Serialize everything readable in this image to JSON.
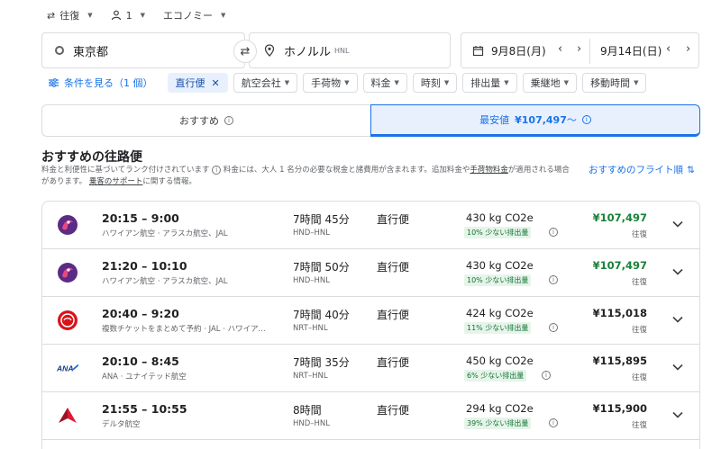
{
  "search": {
    "trip_type": "往復",
    "passengers": "1",
    "cabin": "エコノミー",
    "origin": "東京都",
    "destination": "ホノルル",
    "destination_code": "HNL",
    "depart_date": "9月8日(月)",
    "return_date": "9月14日(日)"
  },
  "filters": {
    "all_filters": "条件を見る（1 個）",
    "chips": [
      "直行便",
      "航空会社",
      "手荷物",
      "料金",
      "時刻",
      "排出量",
      "乗継地",
      "移動時間"
    ]
  },
  "tabs": {
    "recommended": "おすすめ",
    "cheapest_label": "最安値",
    "cheapest_price": "¥107,497",
    "cheapest_suffix": "〜"
  },
  "results": {
    "heading": "おすすめの往路便",
    "sub1": "料金と利便性に基づいてランク付けされています",
    "sub2": "料金には、大人 1 名分の必要な税金と諸費用が含まれます。追加料金や",
    "sub_link1": "手荷物料金",
    "sub3": "が適用される場合があります。",
    "sub_link2": "乗客のサポート",
    "sub4": "に関する情報。",
    "sort_label": "おすすめのフライト順"
  },
  "flights": [
    {
      "logo": "hawaiian",
      "times": "20:15 – 9:00",
      "airlines": "ハワイアン航空 · アラスカ航空、JAL",
      "duration": "7時間 45分",
      "route": "HND–HNL",
      "stops": "直行便",
      "co2": "430 kg CO2e",
      "badge": "10% 少ない排出量",
      "price": "¥107,497",
      "cheap": true,
      "trip": "往復"
    },
    {
      "logo": "hawaiian",
      "times": "21:20 – 10:10",
      "airlines": "ハワイアン航空 · アラスカ航空、JAL",
      "duration": "7時間 50分",
      "route": "HND–HNL",
      "stops": "直行便",
      "co2": "430 kg CO2e",
      "badge": "10% 少ない排出量",
      "price": "¥107,497",
      "cheap": true,
      "trip": "往復"
    },
    {
      "logo": "jal",
      "times": "20:40 – 9:20",
      "airlines": "複数チケットをまとめて予約 · JAL · ハワイアン航空",
      "duration": "7時間 40分",
      "route": "NRT–HNL",
      "stops": "直行便",
      "co2": "424 kg CO2e",
      "badge": "11% 少ない排出量",
      "price": "¥115,018",
      "cheap": false,
      "trip": "往復"
    },
    {
      "logo": "ana",
      "times": "20:10 – 8:45",
      "airlines": "ANA · ユナイテッド航空",
      "duration": "7時間 35分",
      "route": "NRT–HNL",
      "stops": "直行便",
      "co2": "450 kg CO2e",
      "badge": "6% 少ない排出量",
      "price": "¥115,895",
      "cheap": false,
      "trip": "往復"
    },
    {
      "logo": "delta",
      "times": "21:55 – 10:55",
      "airlines": "デルタ航空",
      "duration": "8時間",
      "route": "HND–HNL",
      "stops": "直行便",
      "co2": "294 kg CO2e",
      "badge": "39% 少ない排出量",
      "price": "¥115,900",
      "cheap": false,
      "trip": "往復"
    }
  ],
  "colors": {
    "accent": "#1a73e8",
    "cheap_price": "#188038",
    "badge_bg": "#e6f4ea",
    "badge_text": "#137333"
  }
}
